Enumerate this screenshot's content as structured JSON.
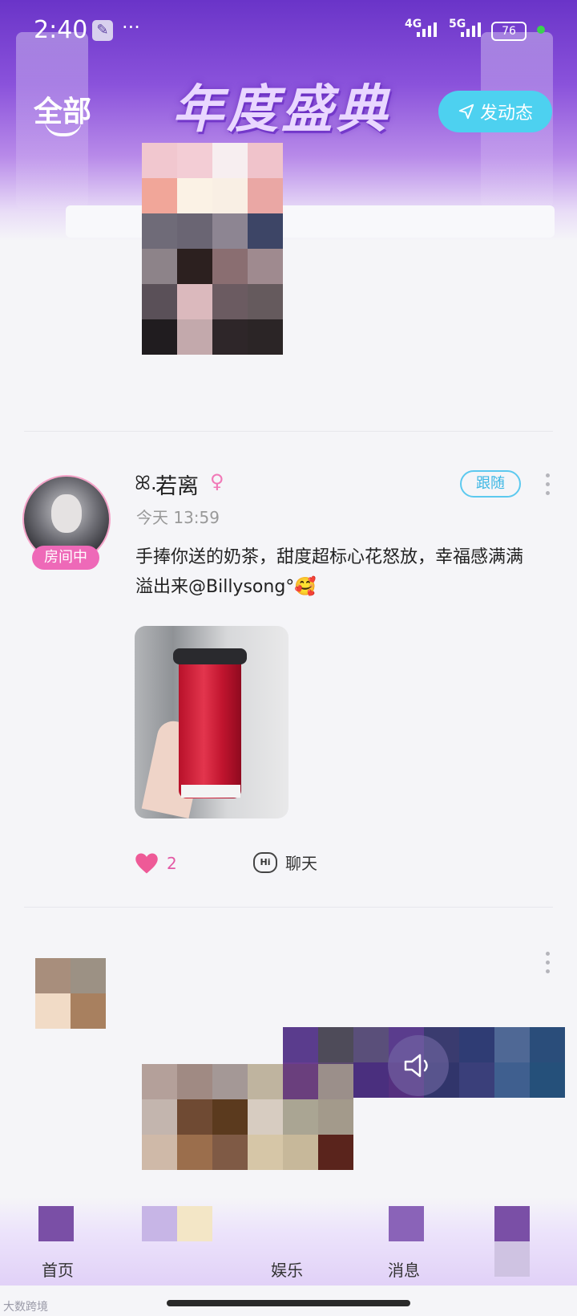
{
  "status_bar": {
    "time": "2:40",
    "tool_icon": "wrench-icon",
    "more_dots": "···",
    "signal_1": "4G",
    "signal_2": "5G",
    "battery": "76"
  },
  "header": {
    "banner_title": "年度盛典",
    "tab_label": "全部",
    "post_button_label": "发动态",
    "post_button_icon": "paper-plane-icon"
  },
  "post": {
    "user_name": "若离",
    "user_name_prefix": "ꕤ.",
    "gender_icon": "female-icon",
    "avatar_badge": "房间中",
    "time": "今天 13:59",
    "follow_label": "跟随",
    "text_line1": "手捧你送的奶茶，甜度超标心花怒放，幸福感满满",
    "text_line2": "溢出来@Billysong°🥰",
    "likes": "2",
    "chat_label": "聊天",
    "chat_icon_text": "Hi"
  },
  "bottom_nav": {
    "items": [
      {
        "label": "首页"
      },
      {
        "label": "娱乐"
      },
      {
        "label": "消息"
      }
    ]
  },
  "watermark": "大数跨境",
  "colors": {
    "accent_cyan": "#4dd1f0",
    "badge_pink": "#ee69b8",
    "like_pink": "#e35aa5"
  }
}
